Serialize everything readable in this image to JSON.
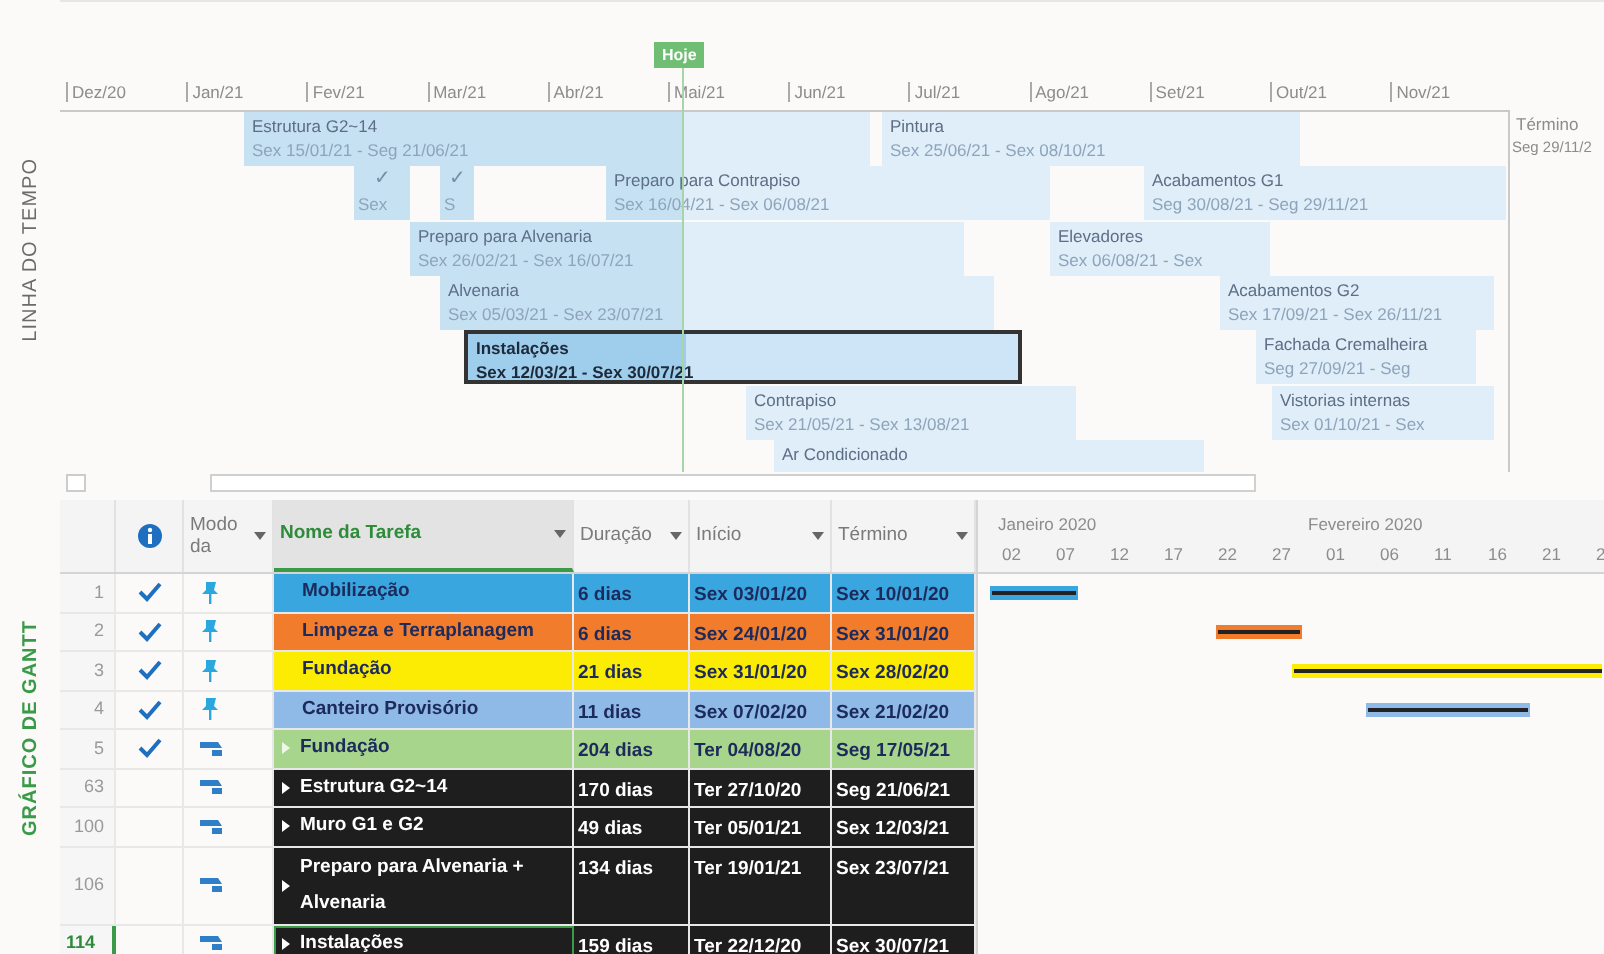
{
  "timeline": {
    "label": "LINHA DO TEMPO",
    "today": "Hoje",
    "months": [
      "Dez/20",
      "Jan/21",
      "Fev/21",
      "Mar/21",
      "Abr/21",
      "Mai/21",
      "Jun/21",
      "Jul/21",
      "Ago/21",
      "Set/21",
      "Out/21",
      "Nov/21"
    ],
    "bars": [
      {
        "kind": "task",
        "title": "Estrutura G2~14",
        "dates": "Sex 15/01/21 - Seg 21/06/21",
        "selected": false
      },
      {
        "kind": "task",
        "title": "Pintura",
        "dates": "Sex 25/06/21 - Sex 08/10/21",
        "selected": false
      },
      {
        "kind": "done",
        "title": "✓",
        "dates": "Sex",
        "selected": false
      },
      {
        "kind": "done",
        "title": "✓",
        "dates": "S",
        "selected": false
      },
      {
        "kind": "task",
        "title": "Preparo para Contrapiso",
        "dates": "Sex 16/04/21 - Sex 06/08/21",
        "selected": false
      },
      {
        "kind": "task",
        "title": "Acabamentos G1",
        "dates": "Seg 30/08/21 - Seg 29/11/21",
        "selected": false
      },
      {
        "kind": "task",
        "title": "Preparo para Alvenaria",
        "dates": "Sex 26/02/21 - Sex 16/07/21",
        "selected": false
      },
      {
        "kind": "task",
        "title": "Elevadores",
        "dates": "Sex 06/08/21 - Sex",
        "selected": false
      },
      {
        "kind": "task",
        "title": "Alvenaria",
        "dates": "Sex 05/03/21 - Sex 23/07/21",
        "selected": false
      },
      {
        "kind": "task",
        "title": "Acabamentos G2",
        "dates": "Sex 17/09/21 - Sex 26/11/21",
        "selected": false
      },
      {
        "kind": "task",
        "title": "Instalações",
        "dates": "Sex 12/03/21 - Sex 30/07/21",
        "selected": true
      },
      {
        "kind": "task",
        "title": "Fachada Cremalheira",
        "dates": "Seg 27/09/21 - Seg",
        "selected": false
      },
      {
        "kind": "task",
        "title": "Contrapiso",
        "dates": "Sex 21/05/21 - Sex 13/08/21",
        "selected": false
      },
      {
        "kind": "task",
        "title": "Vistorias internas",
        "dates": "Sex 01/10/21 - Sex",
        "selected": false
      },
      {
        "kind": "task",
        "title": "Ar Condicionado",
        "selected": false
      }
    ],
    "finish": {
      "label": "Término",
      "date": "Seg 29/11/2"
    }
  },
  "gantt": {
    "label": "GRÁFICO DE GANTT",
    "columns": [
      {
        "kind": "id",
        "selected": false
      },
      {
        "kind": "info",
        "selected": false
      },
      {
        "kind": "mode",
        "title": "Modo da",
        "selected": false
      },
      {
        "kind": "name",
        "title": "Nome da Tarefa",
        "selected": true
      },
      {
        "kind": "duration",
        "title": "Duração",
        "selected": false
      },
      {
        "kind": "start",
        "title": "Início",
        "selected": false
      },
      {
        "kind": "finish",
        "title": "Término",
        "selected": false
      }
    ],
    "rows": [
      {
        "id": "1",
        "done": true,
        "kind": "manual",
        "summary": false,
        "name": "Mobilização",
        "duration": "6 dias",
        "start": "Sex 03/01/20",
        "finish": "Sex 10/01/20",
        "color": "#3aa6df",
        "selected": false
      },
      {
        "id": "2",
        "done": true,
        "kind": "manual",
        "summary": false,
        "name": "Limpeza e Terraplanagem",
        "duration": "6 dias",
        "start": "Sex 24/01/20",
        "finish": "Sex 31/01/20",
        "color": "#f07c2c",
        "selected": false
      },
      {
        "id": "3",
        "done": true,
        "kind": "manual",
        "summary": false,
        "name": "Fundação",
        "duration": "21 dias",
        "start": "Sex 31/01/20",
        "finish": "Sex 28/02/20",
        "color": "#fcec04",
        "selected": false
      },
      {
        "id": "4",
        "done": true,
        "kind": "manual",
        "summary": false,
        "name": "Canteiro Provisório",
        "duration": "11 dias",
        "start": "Sex 07/02/20",
        "finish": "Sex 21/02/20",
        "color": "#8fb9e6",
        "selected": false
      },
      {
        "id": "5",
        "done": true,
        "kind": "auto",
        "summary": true,
        "name": "Fundação",
        "duration": "204 dias",
        "start": "Ter 04/08/20",
        "finish": "Seg 17/05/21",
        "color": "#a7d58b",
        "selected": false
      },
      {
        "id": "63",
        "done": false,
        "kind": "auto",
        "summary": true,
        "name": "Estrutura G2~14",
        "duration": "170 dias",
        "start": "Ter 27/10/20",
        "finish": "Seg 21/06/21",
        "color": "#1e1e1e",
        "selected": false
      },
      {
        "id": "100",
        "done": false,
        "kind": "auto",
        "summary": true,
        "name": "Muro G1 e G2",
        "duration": "49 dias",
        "start": "Ter 05/01/21",
        "finish": "Sex 12/03/21",
        "color": "#1e1e1e",
        "selected": false
      },
      {
        "id": "106",
        "done": false,
        "kind": "auto",
        "summary": true,
        "name": "Preparo para Alvenaria + Alvenaria",
        "duration": "134 dias",
        "start": "Ter 19/01/21",
        "finish": "Sex 23/07/21",
        "color": "#1e1e1e",
        "selected": false
      },
      {
        "id": "114",
        "done": false,
        "kind": "auto",
        "summary": true,
        "name": "Instalações",
        "duration": "159 dias",
        "start": "Ter 22/12/20",
        "finish": "Sex 30/07/21",
        "color": "#1e1e1e",
        "selected": true
      }
    ],
    "chart": {
      "months": [
        "Janeiro 2020",
        "Fevereiro 2020"
      ],
      "days": [
        "02",
        "07",
        "12",
        "17",
        "22",
        "27",
        "01",
        "06",
        "11",
        "16",
        "21",
        "2"
      ]
    }
  }
}
